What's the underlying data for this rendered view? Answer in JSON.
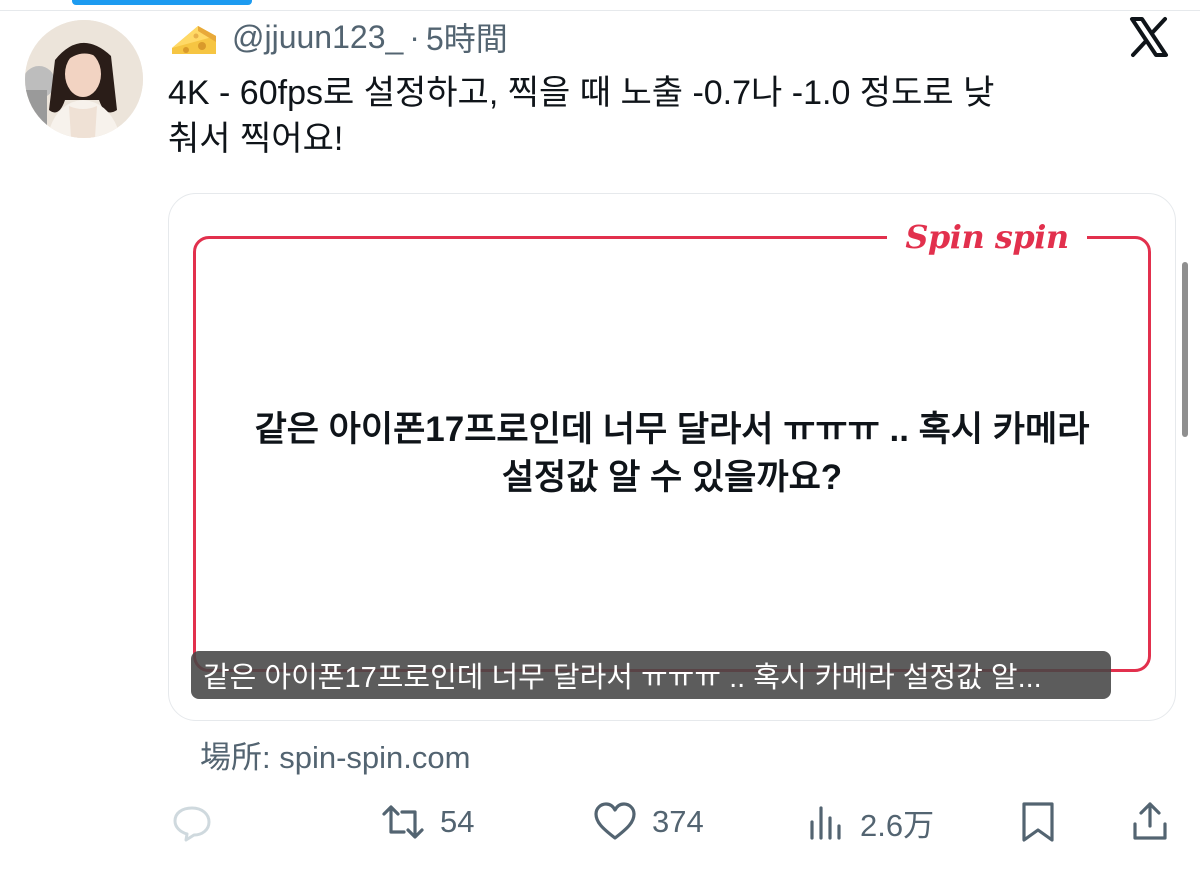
{
  "post": {
    "author_handle": "@jjuun123_",
    "separator": "·",
    "time": "5時間",
    "text": "4K - 60fps로 설정하고, 찍을 때 노출 -0.7나 -1.0 정도로 낮\n춰서 찍어요!"
  },
  "card": {
    "brand": "Spin spin",
    "question": "같은 아이폰17프로인데 너무 달라서 ㅠㅠㅠ .. 혹시 카메라\n설정값 알 수 있을까요?",
    "caption": "같은 아이폰17프로인데 너무 달라서 ㅠㅠㅠ .. 혹시 카메라 설정값 알..."
  },
  "location": "場所: spin-spin.com",
  "actions": {
    "reply_count": "",
    "repost_count": "54",
    "like_count": "374",
    "view_count": "2.6万"
  },
  "colors": {
    "accent": "#1d9bf0",
    "brand_red": "#e2304d",
    "muted_text": "#536471"
  },
  "icons": [
    "cheese-emoji-icon",
    "x-logo-icon",
    "reply-icon",
    "repost-icon",
    "heart-icon",
    "views-icon",
    "bookmark-icon",
    "share-icon"
  ]
}
